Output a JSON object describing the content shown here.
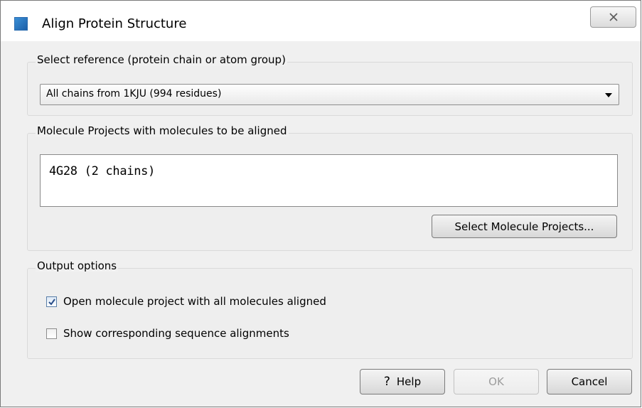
{
  "window": {
    "title": "Align Protein Structure",
    "close_icon": "close-icon"
  },
  "reference": {
    "label": "Select reference (protein chain or atom group)",
    "selected": "All chains from 1KJU (994 residues)"
  },
  "molecules": {
    "label": "Molecule Projects with molecules to be aligned",
    "items": [
      "4G28 (2 chains)"
    ],
    "select_button": "Select Molecule Projects..."
  },
  "output": {
    "label": "Output options",
    "options": [
      {
        "label": "Open molecule project with all molecules aligned",
        "checked": true
      },
      {
        "label": "Show corresponding sequence alignments",
        "checked": false
      }
    ]
  },
  "footer": {
    "help_label": "Help",
    "help_icon": "?",
    "ok_label": "OK",
    "cancel_label": "Cancel"
  }
}
